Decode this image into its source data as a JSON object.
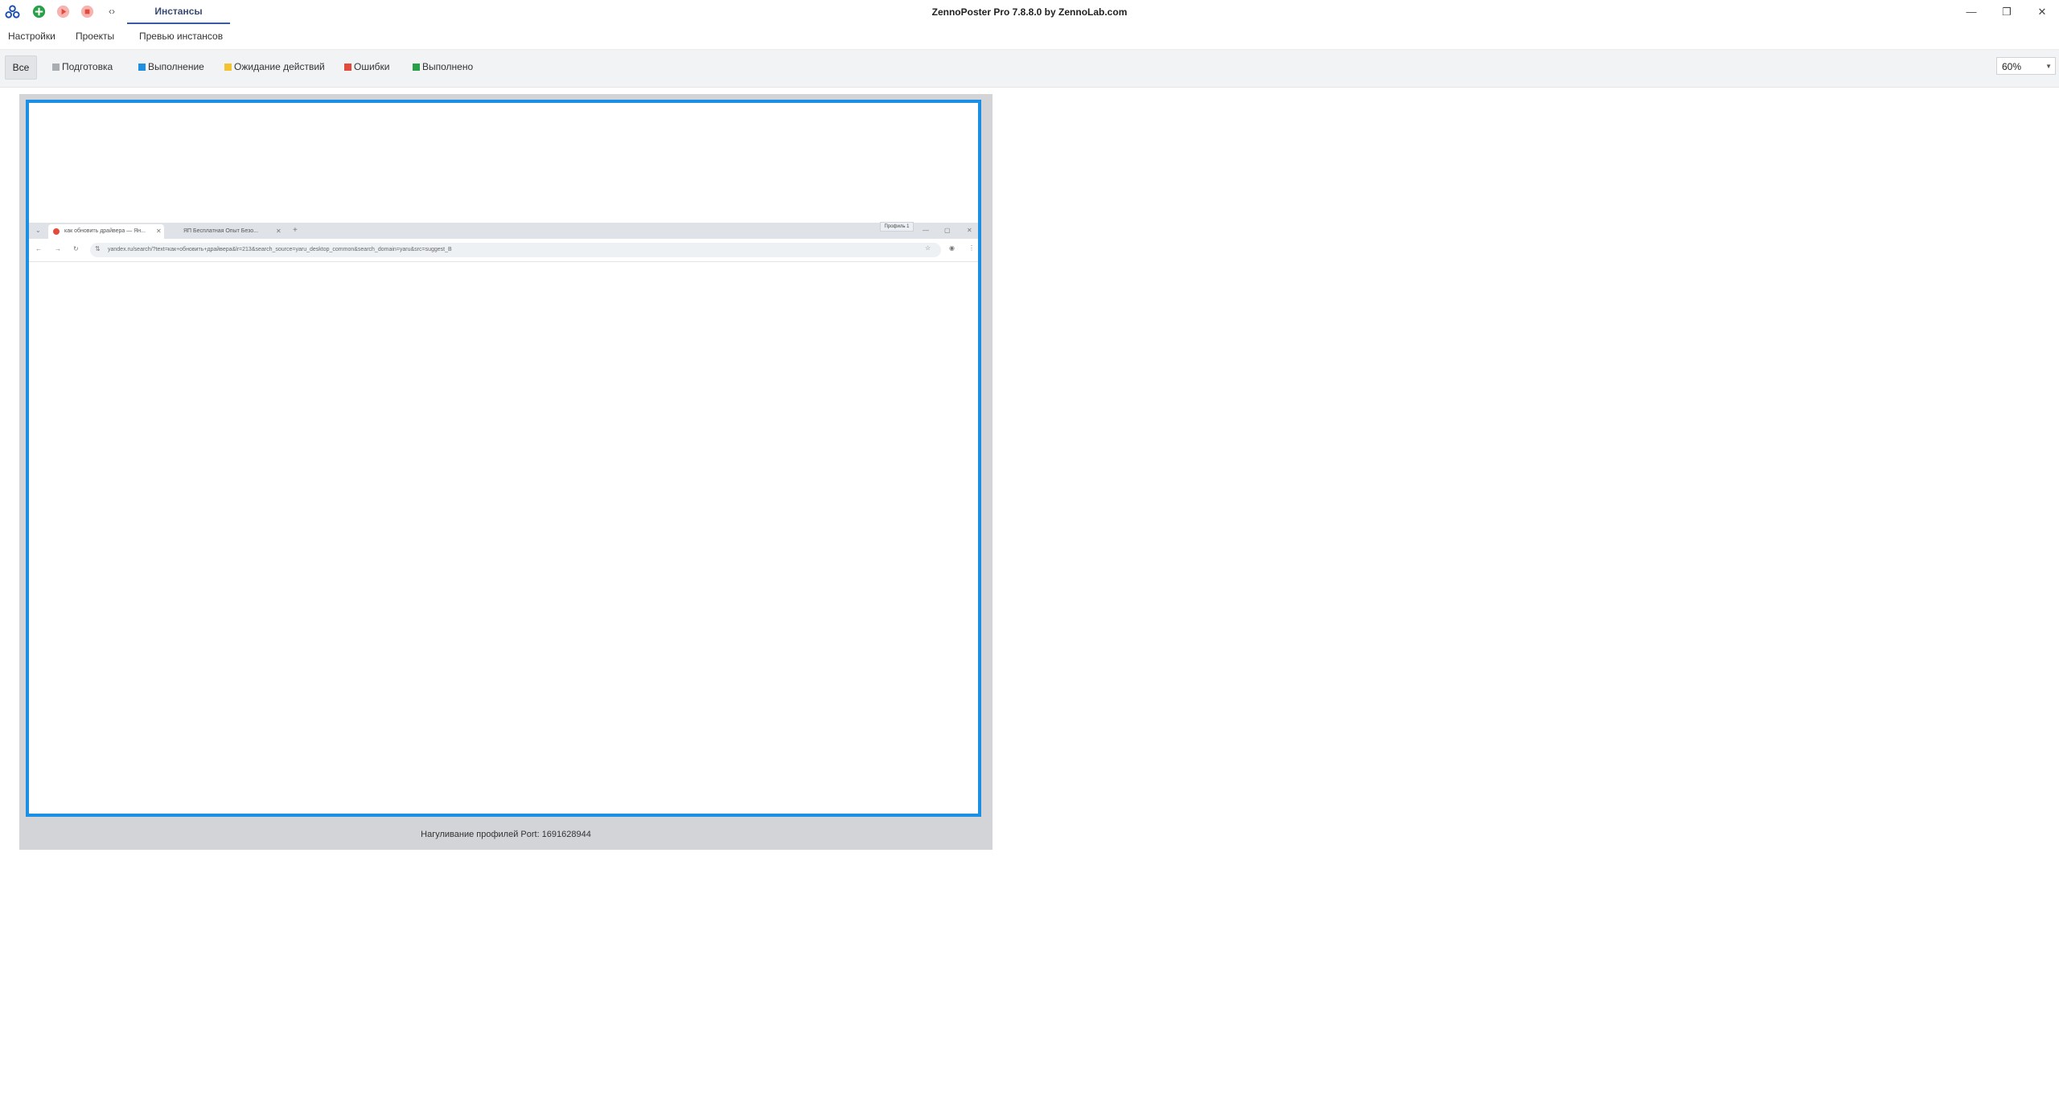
{
  "app": {
    "title": "ZennoPoster Pro 7.8.8.0 by ZennoLab.com",
    "active_tab": "Инстансы",
    "more_glyph": "‹›"
  },
  "window_controls": {
    "minimize": "—",
    "restore": "❐",
    "close": "✕"
  },
  "menu": [
    "Настройки",
    "Проекты",
    "Превью инстансов"
  ],
  "filters": {
    "all": "Все",
    "items": [
      {
        "label": "Подготовка",
        "color": "#a9acb1"
      },
      {
        "label": "Выполнение",
        "color": "#1f8fe0"
      },
      {
        "label": "Ожидание действий",
        "color": "#f2c230"
      },
      {
        "label": "Ошибки",
        "color": "#e24b3b"
      },
      {
        "label": "Выполнено",
        "color": "#27a048"
      }
    ]
  },
  "zoom": {
    "value": "60%"
  },
  "instance": {
    "caption": "Нагуливание профилей Port: 1691628944",
    "browser": {
      "tabs": [
        {
          "label": "как обновить драйвера — Ян..."
        },
        {
          "label": "ЯП Бесплатная Опыт Безо..."
        }
      ],
      "new_tab": "+",
      "profile_label": "Профиль 1",
      "url": "yandex.ru/search/?text=как+обновить+драйвера&lr=213&search_source=yaru_desktop_common&search_domain=yaru&src=suggest_B"
    }
  },
  "colors": {
    "accent": "#1a8fe3",
    "active_tab_underline": "#3a5aa8"
  }
}
